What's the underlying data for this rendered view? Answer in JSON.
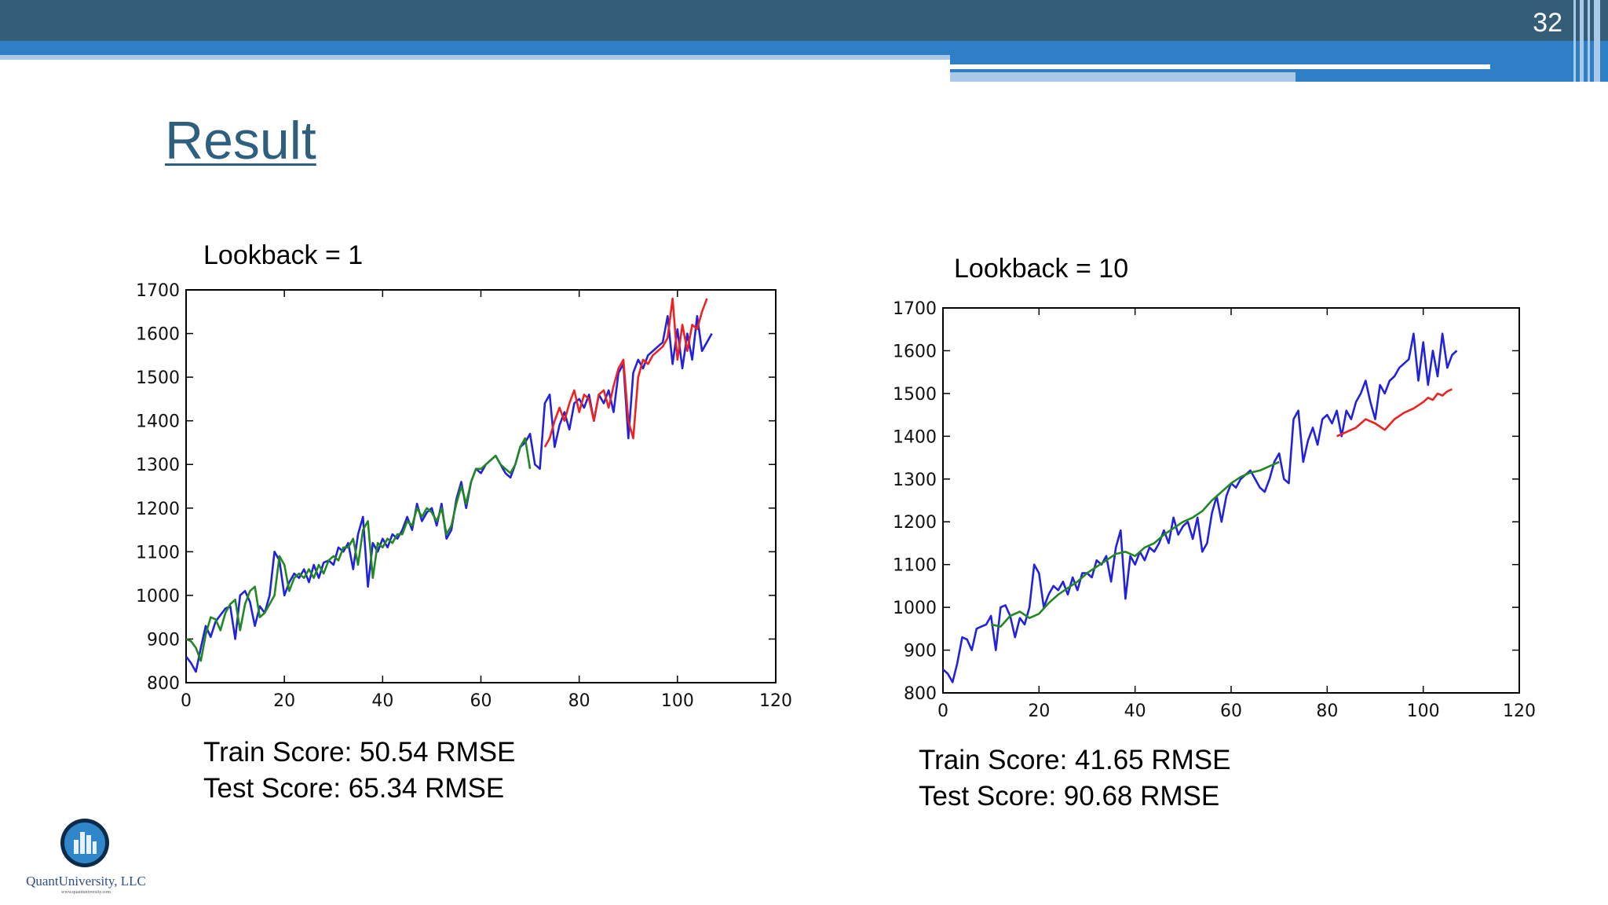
{
  "slide": {
    "page_number": "32",
    "title": "Result"
  },
  "left_panel": {
    "caption": "Lookback = 1",
    "train_score": "Train Score: 50.54 RMSE",
    "test_score": "Test Score: 65.34 RMSE"
  },
  "right_panel": {
    "caption": "Lookback = 10",
    "train_score": "Train Score: 41.65 RMSE",
    "test_score": "Test Score: 90.68 RMSE"
  },
  "logo": {
    "name": "QuantUniversity, LLC",
    "url": "www.quantuniversity.com"
  },
  "colors": {
    "actual": "#2222dd",
    "train_prediction": "#228822",
    "test_prediction": "#ee2222",
    "header": "#345d78",
    "title": "#2e5f7e"
  },
  "chart_data": [
    {
      "type": "line",
      "title": "",
      "xlabel": "",
      "ylabel": "",
      "xlim": [
        0,
        120
      ],
      "ylim": [
        800,
        1700
      ],
      "xticks": [
        0,
        20,
        40,
        60,
        80,
        100,
        120
      ],
      "yticks": [
        800,
        900,
        1000,
        1100,
        1200,
        1300,
        1400,
        1500,
        1600,
        1700
      ],
      "grid": false,
      "series": [
        {
          "role": "actual",
          "color": "#2222dd",
          "x": [
            0,
            1,
            2,
            3,
            4,
            5,
            6,
            7,
            8,
            9,
            10,
            11,
            12,
            13,
            14,
            15,
            16,
            17,
            18,
            19,
            20,
            21,
            22,
            23,
            24,
            25,
            26,
            27,
            28,
            29,
            30,
            31,
            32,
            33,
            34,
            35,
            36,
            37,
            38,
            39,
            40,
            41,
            42,
            43,
            44,
            45,
            46,
            47,
            48,
            49,
            50,
            51,
            52,
            53,
            54,
            55,
            56,
            57,
            58,
            59,
            60,
            61,
            62,
            63,
            64,
            65,
            66,
            67,
            68,
            69,
            70,
            71,
            72,
            73,
            74,
            75,
            76,
            77,
            78,
            79,
            80,
            81,
            82,
            83,
            84,
            85,
            86,
            87,
            88,
            89,
            90,
            91,
            92,
            93,
            94,
            95,
            96,
            97,
            98,
            99,
            100,
            101,
            102,
            103,
            104,
            105,
            106,
            107
          ],
          "y": [
            860,
            845,
            825,
            880,
            930,
            905,
            940,
            955,
            970,
            975,
            900,
            1000,
            1010,
            985,
            930,
            975,
            960,
            1000,
            1100,
            1080,
            1000,
            1030,
            1050,
            1040,
            1060,
            1030,
            1070,
            1040,
            1075,
            1080,
            1070,
            1110,
            1100,
            1120,
            1060,
            1140,
            1180,
            1020,
            1120,
            1100,
            1130,
            1110,
            1140,
            1130,
            1150,
            1180,
            1150,
            1210,
            1170,
            1190,
            1200,
            1160,
            1210,
            1130,
            1150,
            1220,
            1260,
            1200,
            1260,
            1290,
            1280,
            1300,
            1310,
            1320,
            1300,
            1280,
            1270,
            1300,
            1340,
            1350,
            1370,
            1300,
            1290,
            1440,
            1460,
            1340,
            1390,
            1420,
            1380,
            1440,
            1450,
            1430,
            1460,
            1400,
            1460,
            1440,
            1470,
            1420,
            1510,
            1530,
            1360,
            1510,
            1540,
            1520,
            1550,
            1560,
            1570,
            1580,
            1640,
            1530,
            1610,
            1520,
            1600,
            1540,
            1640,
            1560,
            1580,
            1600
          ]
        },
        {
          "role": "train prediction",
          "color": "#228822",
          "x": [
            0,
            1,
            2,
            3,
            4,
            5,
            6,
            7,
            8,
            9,
            10,
            11,
            12,
            13,
            14,
            15,
            16,
            17,
            18,
            19,
            20,
            21,
            22,
            23,
            24,
            25,
            26,
            27,
            28,
            29,
            30,
            31,
            32,
            33,
            34,
            35,
            36,
            37,
            38,
            39,
            40,
            41,
            42,
            43,
            44,
            45,
            46,
            47,
            48,
            49,
            50,
            51,
            52,
            53,
            54,
            55,
            56,
            57,
            58,
            59,
            60,
            61,
            62,
            63,
            64,
            65,
            66,
            67,
            68,
            69,
            70
          ],
          "y": [
            900,
            895,
            880,
            850,
            910,
            950,
            945,
            920,
            960,
            980,
            990,
            920,
            980,
            1010,
            1020,
            950,
            960,
            980,
            1000,
            1090,
            1070,
            1010,
            1040,
            1050,
            1040,
            1060,
            1040,
            1070,
            1050,
            1080,
            1090,
            1080,
            1110,
            1110,
            1130,
            1070,
            1150,
            1170,
            1040,
            1120,
            1110,
            1130,
            1120,
            1140,
            1140,
            1170,
            1160,
            1200,
            1180,
            1200,
            1190,
            1170,
            1200,
            1140,
            1160,
            1210,
            1250,
            1210,
            1260,
            1290,
            1290,
            1300,
            1310,
            1320,
            1300,
            1290,
            1280,
            1300,
            1340,
            1360,
            1290
          ]
        },
        {
          "role": "test prediction",
          "color": "#ee2222",
          "x": [
            73,
            74,
            75,
            76,
            77,
            78,
            79,
            80,
            81,
            82,
            83,
            84,
            85,
            86,
            87,
            88,
            89,
            90,
            91,
            92,
            93,
            94,
            95,
            96,
            97,
            98,
            99,
            100,
            101,
            102,
            103,
            104,
            105,
            106
          ],
          "y": [
            1340,
            1360,
            1400,
            1430,
            1400,
            1440,
            1470,
            1420,
            1460,
            1450,
            1400,
            1460,
            1470,
            1430,
            1480,
            1520,
            1540,
            1400,
            1360,
            1500,
            1540,
            1530,
            1550,
            1560,
            1570,
            1590,
            1680,
            1540,
            1620,
            1560,
            1620,
            1610,
            1650,
            1680
          ]
        }
      ]
    },
    {
      "type": "line",
      "title": "",
      "xlabel": "",
      "ylabel": "",
      "xlim": [
        0,
        120
      ],
      "ylim": [
        800,
        1700
      ],
      "xticks": [
        0,
        20,
        40,
        60,
        80,
        100,
        120
      ],
      "yticks": [
        800,
        900,
        1000,
        1100,
        1200,
        1300,
        1400,
        1500,
        1600,
        1700
      ],
      "grid": false,
      "series": [
        {
          "role": "actual",
          "color": "#2222dd",
          "x": [
            0,
            1,
            2,
            3,
            4,
            5,
            6,
            7,
            8,
            9,
            10,
            11,
            12,
            13,
            14,
            15,
            16,
            17,
            18,
            19,
            20,
            21,
            22,
            23,
            24,
            25,
            26,
            27,
            28,
            29,
            30,
            31,
            32,
            33,
            34,
            35,
            36,
            37,
            38,
            39,
            40,
            41,
            42,
            43,
            44,
            45,
            46,
            47,
            48,
            49,
            50,
            51,
            52,
            53,
            54,
            55,
            56,
            57,
            58,
            59,
            60,
            61,
            62,
            63,
            64,
            65,
            66,
            67,
            68,
            69,
            70,
            71,
            72,
            73,
            74,
            75,
            76,
            77,
            78,
            79,
            80,
            81,
            82,
            83,
            84,
            85,
            86,
            87,
            88,
            89,
            90,
            91,
            92,
            93,
            94,
            95,
            96,
            97,
            98,
            99,
            100,
            101,
            102,
            103,
            104,
            105,
            106,
            107
          ],
          "y": [
            855,
            845,
            825,
            870,
            930,
            925,
            900,
            950,
            955,
            960,
            980,
            900,
            1000,
            1005,
            980,
            930,
            975,
            960,
            1000,
            1100,
            1080,
            1000,
            1030,
            1050,
            1040,
            1060,
            1030,
            1070,
            1040,
            1080,
            1080,
            1070,
            1110,
            1100,
            1120,
            1060,
            1140,
            1180,
            1020,
            1120,
            1100,
            1130,
            1110,
            1140,
            1130,
            1150,
            1180,
            1150,
            1210,
            1170,
            1190,
            1200,
            1160,
            1210,
            1130,
            1150,
            1220,
            1260,
            1200,
            1260,
            1290,
            1280,
            1300,
            1310,
            1320,
            1300,
            1280,
            1270,
            1300,
            1340,
            1360,
            1300,
            1290,
            1440,
            1460,
            1340,
            1390,
            1420,
            1380,
            1440,
            1450,
            1430,
            1460,
            1400,
            1460,
            1440,
            1480,
            1500,
            1530,
            1480,
            1440,
            1520,
            1500,
            1530,
            1540,
            1560,
            1570,
            1580,
            1640,
            1530,
            1620,
            1520,
            1600,
            1540,
            1640,
            1560,
            1590,
            1600
          ]
        },
        {
          "role": "train prediction",
          "color": "#228822",
          "x": [
            10,
            12,
            14,
            16,
            18,
            20,
            22,
            24,
            26,
            28,
            30,
            32,
            34,
            36,
            38,
            40,
            42,
            44,
            46,
            48,
            50,
            52,
            54,
            56,
            58,
            60,
            62,
            64,
            66,
            68,
            70
          ],
          "y": [
            960,
            955,
            980,
            990,
            975,
            985,
            1010,
            1030,
            1045,
            1060,
            1080,
            1095,
            1110,
            1125,
            1130,
            1120,
            1140,
            1150,
            1170,
            1185,
            1200,
            1210,
            1225,
            1250,
            1270,
            1290,
            1305,
            1315,
            1320,
            1330,
            1340
          ]
        },
        {
          "role": "test prediction",
          "color": "#ee2222",
          "x": [
            82,
            84,
            86,
            88,
            90,
            92,
            94,
            96,
            98,
            100,
            101,
            102,
            103,
            104,
            105,
            106
          ],
          "y": [
            1400,
            1410,
            1420,
            1440,
            1430,
            1415,
            1440,
            1455,
            1465,
            1480,
            1490,
            1485,
            1500,
            1495,
            1505,
            1510
          ]
        }
      ]
    }
  ]
}
